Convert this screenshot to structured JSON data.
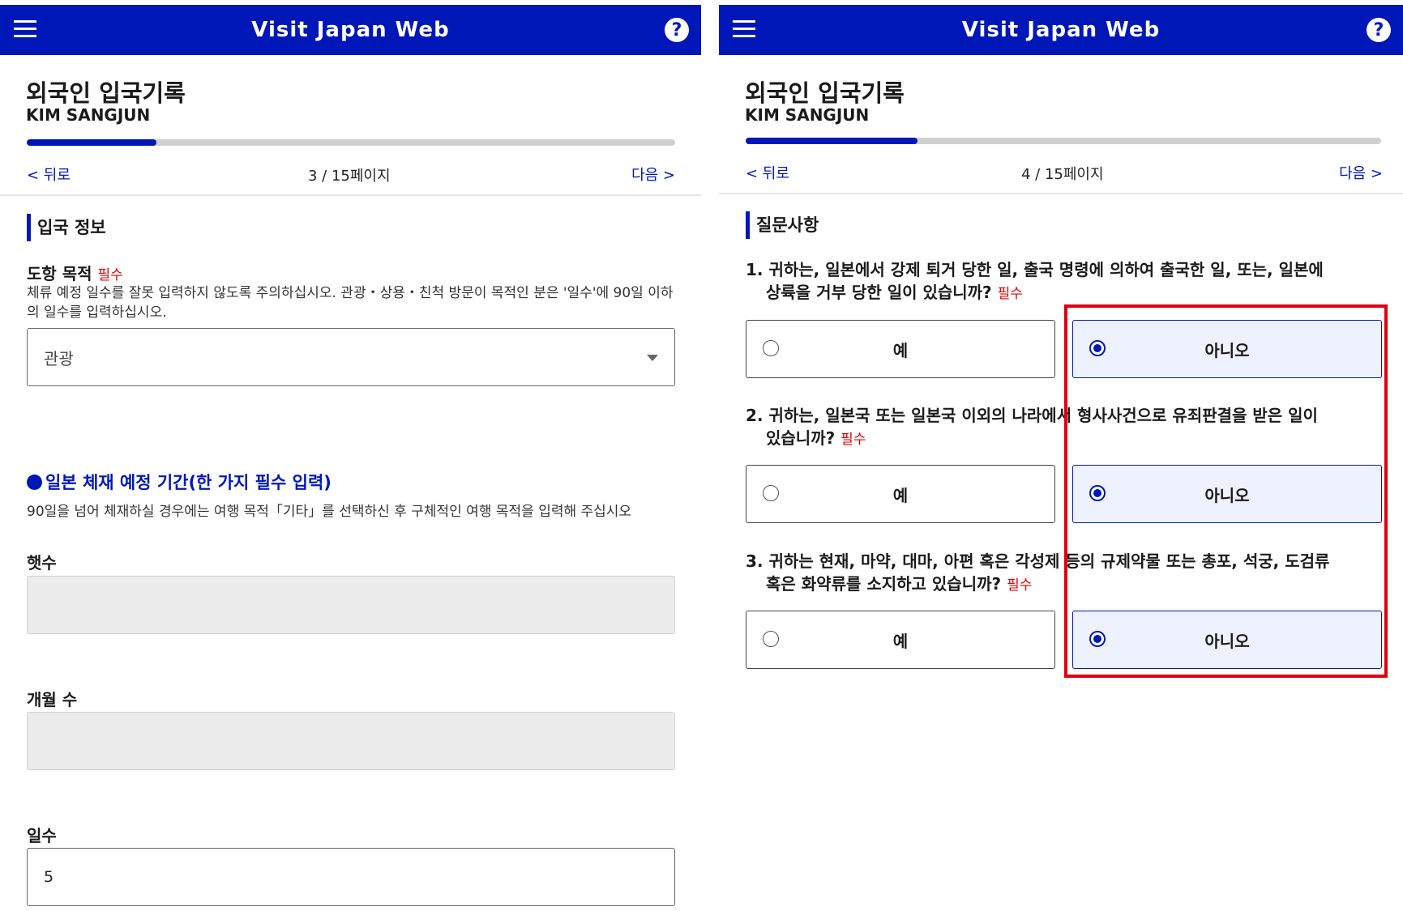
{
  "app": {
    "title": "Visit Japan Web"
  },
  "left": {
    "page_title": "외국인 입국기록",
    "user_name": "KIM SANGJUN",
    "progress": 0.2,
    "nav": {
      "back": "< 뒤로",
      "page": "3 / 15페이지",
      "next": "다음 >"
    },
    "section": "입국 정보",
    "purpose": {
      "label": "도항 목적",
      "required": "필수",
      "help": "체류 예정 일수를 잘못 입력하지 않도록 주의하십시오. 관광・상용・친척 방문이 목적인 분은 '일수'에 90일 이하의 일수를 입력하십시오.",
      "value": "관광"
    },
    "stay": {
      "heading": "일본 체재 예정 기간(한 가지 필수 입력)",
      "help": "90일을 넘어 체재하실 경우에는 여행 목적「기타」를 선택하신 후 구체적인 여행 목적을 입력해 주십시오",
      "years_label": "햇수",
      "months_label": "개월 수",
      "days_label": "일수",
      "days_value": "5"
    }
  },
  "right": {
    "page_title": "외국인 입국기록",
    "user_name": "KIM SANGJUN",
    "progress": 0.27,
    "nav": {
      "back": "< 뒤로",
      "page": "4 / 15페이지",
      "next": "다음 >"
    },
    "section": "질문사항",
    "yes_label": "예",
    "no_label": "아니오",
    "required": "필수",
    "questions": [
      {
        "line1": "1. 귀하는, 일본에서 강제 퇴거 당한 일, 출국 명령에 의하여 출국한 일, 또는, 일본에",
        "line2": "상륙을 거부 당한 일이 있습니까?",
        "answer": "아니오"
      },
      {
        "line1": "2. 귀하는, 일본국 또는 일본국 이외의 나라에서 형사사건으로 유죄판결을 받은 일이",
        "line2": "있습니까?",
        "answer": "아니오"
      },
      {
        "line1": "3. 귀하는 현재, 마약, 대마, 아편 혹은 각성제 등의 규제약물 또는 총포, 석궁, 도검류",
        "line2": "혹은 화약류를 소지하고 있습니까?",
        "answer": "아니오"
      }
    ]
  },
  "colors": {
    "brand": "#0017b8",
    "required": "#e00000",
    "highlight": "#e00010"
  }
}
